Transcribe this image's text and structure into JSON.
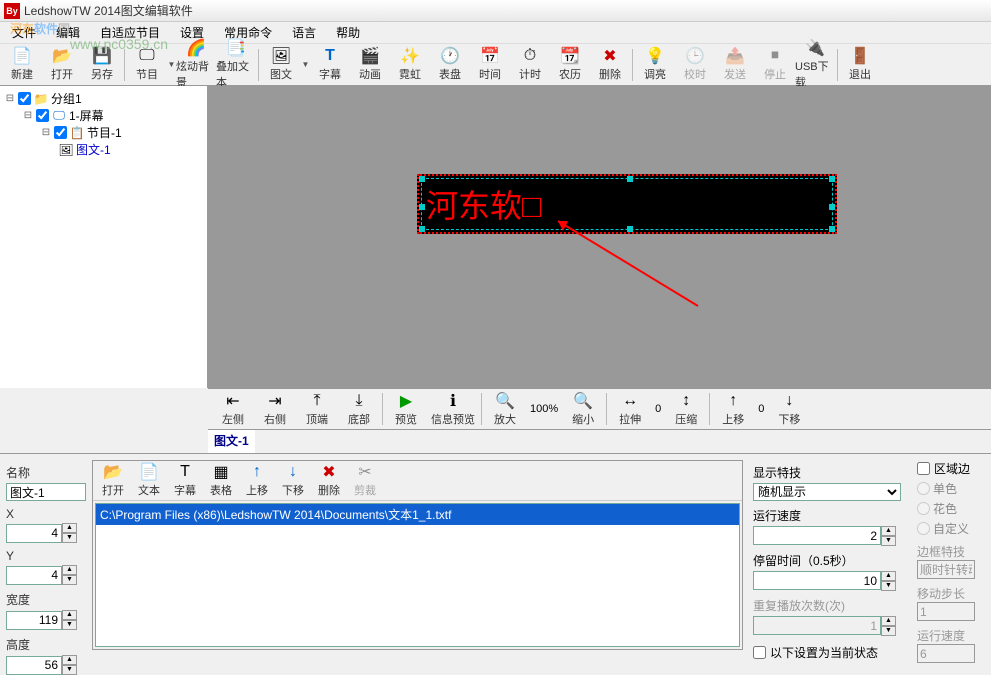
{
  "title": "LedshowTW 2014图文编辑软件",
  "menu": [
    "文件",
    "编辑",
    "自适应节目",
    "设置",
    "常用命令",
    "语言",
    "帮助"
  ],
  "toolbar": [
    {
      "label": "新建",
      "icon": "📄"
    },
    {
      "label": "打开",
      "icon": "📂"
    },
    {
      "label": "另存",
      "icon": "💾"
    },
    {
      "label": "节目",
      "icon": "🖵",
      "drop": true
    },
    {
      "label": "炫动背景",
      "icon": "🌈"
    },
    {
      "label": "叠加文本",
      "icon": "📑"
    },
    {
      "label": "图文",
      "icon": "🖼",
      "drop": true
    },
    {
      "label": "字幕",
      "icon": "T"
    },
    {
      "label": "动画",
      "icon": "🎬"
    },
    {
      "label": "霓虹",
      "icon": "✨"
    },
    {
      "label": "表盘",
      "icon": "🕐"
    },
    {
      "label": "时间",
      "icon": "📅"
    },
    {
      "label": "计时",
      "icon": "⏱"
    },
    {
      "label": "农历",
      "icon": "📆"
    },
    {
      "label": "删除",
      "icon": "✖"
    },
    {
      "label": "调亮",
      "icon": "💡"
    },
    {
      "label": "校时",
      "icon": "🕒",
      "disabled": true
    },
    {
      "label": "发送",
      "icon": "📤",
      "disabled": true
    },
    {
      "label": "停止",
      "icon": "⏹",
      "disabled": true
    },
    {
      "label": "USB下载",
      "icon": "🔌"
    },
    {
      "label": "退出",
      "icon": "🚪"
    }
  ],
  "tree": {
    "root": "分组1",
    "screen": "1-屏幕",
    "program": "节目-1",
    "item": "图文-1"
  },
  "led_text": "河东软□",
  "lower_toolbar": {
    "left": "左侧",
    "right": "右侧",
    "top": "顶端",
    "bottom": "底部",
    "preview": "预览",
    "info": "信息预览",
    "zoomin": "放大",
    "zoom": "100%",
    "zoomout": "缩小",
    "stretch": "拉伸",
    "sval": "0",
    "compress": "压缩",
    "moveup": "上移",
    "mval": "0",
    "movedown": "下移"
  },
  "tab": "图文-1",
  "props": {
    "name_label": "名称",
    "name_value": "图文-1",
    "x_label": "X",
    "x_value": "4",
    "y_label": "Y",
    "y_value": "4",
    "w_label": "宽度",
    "w_value": "119",
    "h_label": "高度",
    "h_value": "56"
  },
  "file_toolbar": [
    "打开",
    "文本",
    "字幕",
    "表格",
    "上移",
    "下移",
    "删除",
    "剪裁"
  ],
  "file_path": "C:\\Program Files (x86)\\LedshowTW 2014\\Documents\\文本1_1.txtf",
  "effects": {
    "display_label": "显示特技",
    "display_value": "随机显示",
    "speed_label": "运行速度",
    "speed_value": "2",
    "stay_label": "停留时间（0.5秒）",
    "stay_value": "10",
    "repeat_label": "重复播放次数(次)",
    "repeat_value": "1",
    "check_label": "以下设置为当前状态"
  },
  "border": {
    "area_label": "区域边",
    "r1": "单色",
    "r2": "花色",
    "r3": "自定义",
    "frame_label": "边框特技",
    "frame_value": "顺时针转动",
    "step_label": "移动步长",
    "step_value": "1",
    "speed_label": "运行速度",
    "speed_value": "6"
  },
  "watermark": {
    "t1": "河东",
    "t2": "软件",
    "t3": "园",
    "sub": "www.pc0359.cn"
  }
}
